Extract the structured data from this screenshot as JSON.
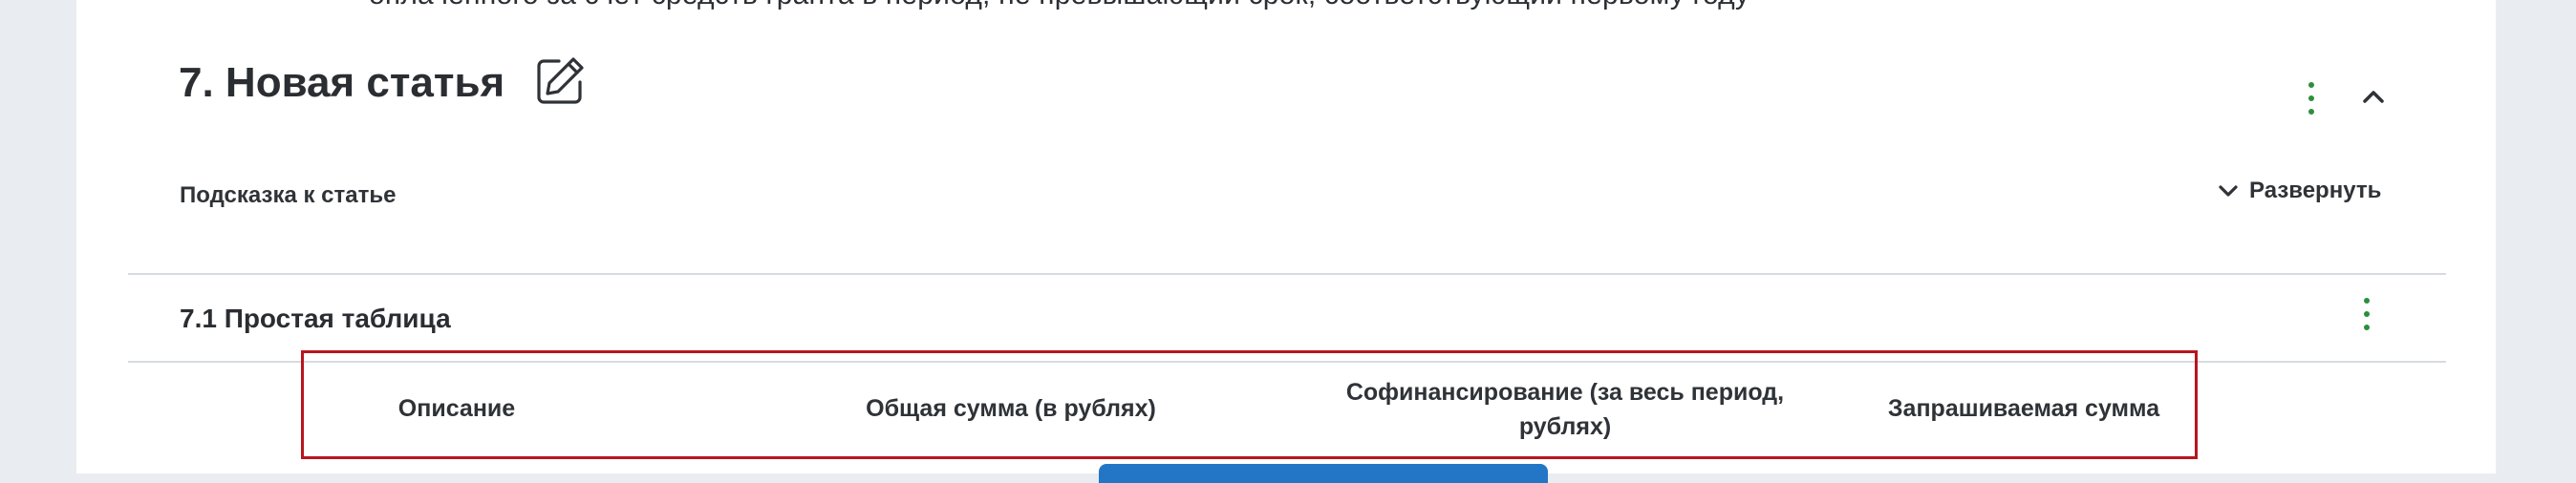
{
  "top_cut_text": "оплаченного за счёт средств гранта в период, не превышающий срок, соответствующий первому году",
  "article": {
    "title": "7. Новая статья",
    "hint_label": "Подсказка к статье",
    "expand_label": "Развернуть"
  },
  "section": {
    "title": "7.1 Простая таблица"
  },
  "table": {
    "headers": [
      "Описание",
      "Общая сумма (в рублях)",
      "Софинансирование (за весь период, рублях)",
      "Запрашиваемая сумма"
    ]
  },
  "colors": {
    "accent_green": "#2c8f3c",
    "highlight_red": "#b8161d",
    "primary_blue": "#2276c5"
  },
  "icons": [
    "edit-icon",
    "kebab-menu-icon",
    "chevron-up-icon",
    "chevron-down-icon"
  ]
}
